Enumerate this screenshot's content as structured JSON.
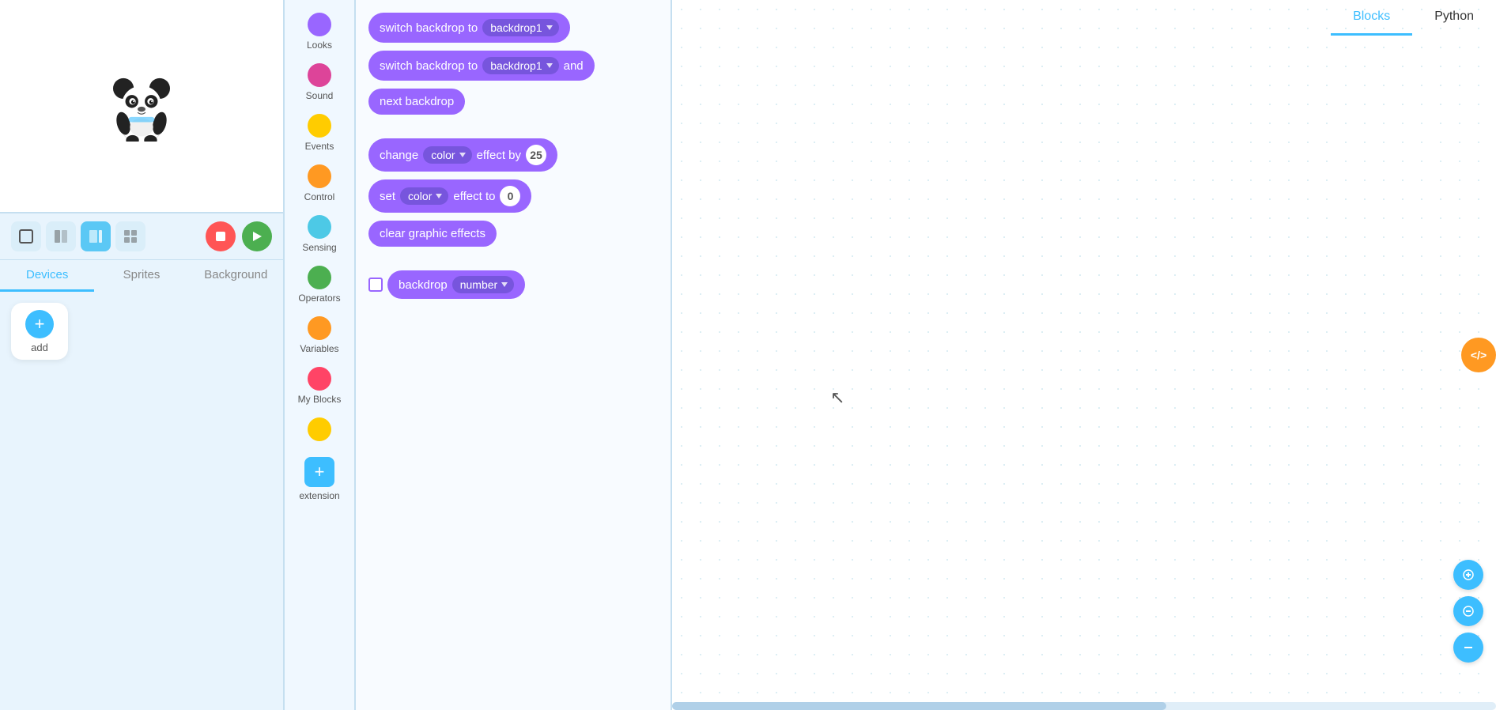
{
  "leftPanel": {
    "tabs": [
      {
        "label": "Devices",
        "active": true
      },
      {
        "label": "Sprites",
        "active": false
      },
      {
        "label": "Background",
        "active": false
      }
    ],
    "addLabel": "add"
  },
  "categories": [
    {
      "label": "Looks",
      "color": "#9966ff"
    },
    {
      "label": "Sound",
      "color": "#dd4499"
    },
    {
      "label": "Events",
      "color": "#ffcc00"
    },
    {
      "label": "Control",
      "color": "#ff9922"
    },
    {
      "label": "Sensing",
      "color": "#4dc9e6"
    },
    {
      "label": "Operators",
      "color": "#4caf50"
    },
    {
      "label": "Variables",
      "color": "#ff9922"
    },
    {
      "label": "My Blocks",
      "color": "#ff4466"
    },
    {
      "label": "",
      "color": "#ffcc00"
    },
    {
      "label": "extension",
      "color": "#3dbeff",
      "isExtension": true
    }
  ],
  "blocks": [
    {
      "type": "switch_backdrop",
      "text": "switch backdrop to",
      "dropdown": "backdrop1"
    },
    {
      "type": "switch_backdrop_wait",
      "text": "switch backdrop to",
      "dropdown": "backdrop1",
      "suffix": "and"
    },
    {
      "type": "next_backdrop",
      "text": "next backdrop"
    },
    {
      "type": "change_effect",
      "prefix": "change",
      "dropdown": "color",
      "suffix": "effect by",
      "value": "25"
    },
    {
      "type": "set_effect",
      "prefix": "set",
      "dropdown": "color",
      "suffix": "effect to",
      "value": "0"
    },
    {
      "type": "clear_effects",
      "text": "clear graphic effects"
    },
    {
      "type": "backdrop_reporter",
      "prefix": "backdrop",
      "dropdown": "number",
      "hasCheckbox": true
    }
  ],
  "topTabs": [
    {
      "label": "Blocks",
      "active": true
    },
    {
      "label": "Python",
      "active": false
    }
  ],
  "codeIcon": "</>",
  "zoomControls": [
    "+",
    "-",
    "="
  ]
}
